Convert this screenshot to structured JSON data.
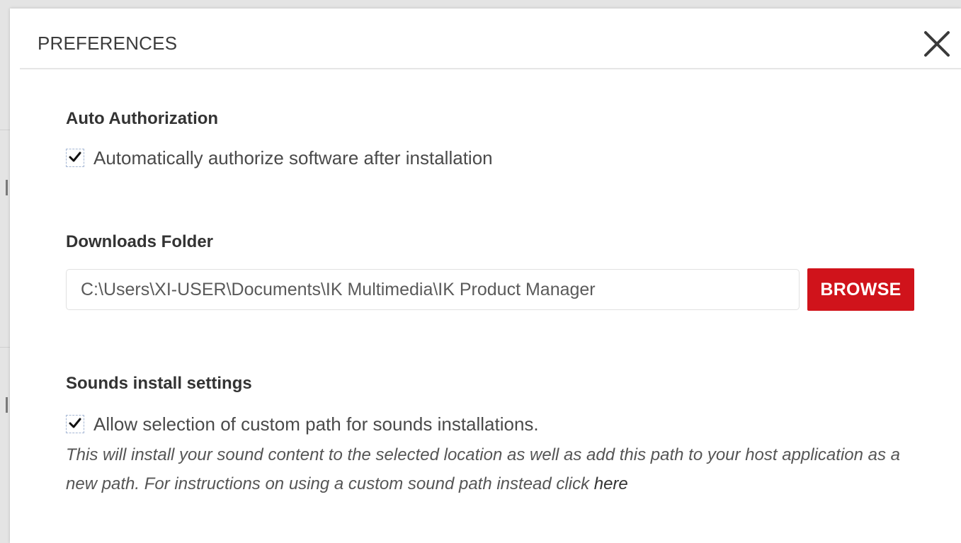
{
  "dialog": {
    "title": "PREFERENCES",
    "close_icon": "close-icon"
  },
  "auto_authorization": {
    "heading": "Auto Authorization",
    "checkbox_label": "Automatically authorize software after installation",
    "checked": true
  },
  "downloads_folder": {
    "heading": "Downloads Folder",
    "path_value": "C:\\Users\\XI-USER\\Documents\\IK Multimedia\\IK Product Manager",
    "browse_label": "BROWSE"
  },
  "sounds_install": {
    "heading": "Sounds install settings",
    "checkbox_label": "Allow selection of custom path for sounds installations.",
    "checked": true,
    "note_text": "This will install your sound content to the selected location as well as add this path to your host application as a new path. For instructions on using a custom sound path instead click ",
    "note_link": "here"
  },
  "colors": {
    "accent": "#d0131b",
    "checkbox_border": "#a5b7d4"
  },
  "icons": [
    "close-icon",
    "checkmark-icon"
  ]
}
